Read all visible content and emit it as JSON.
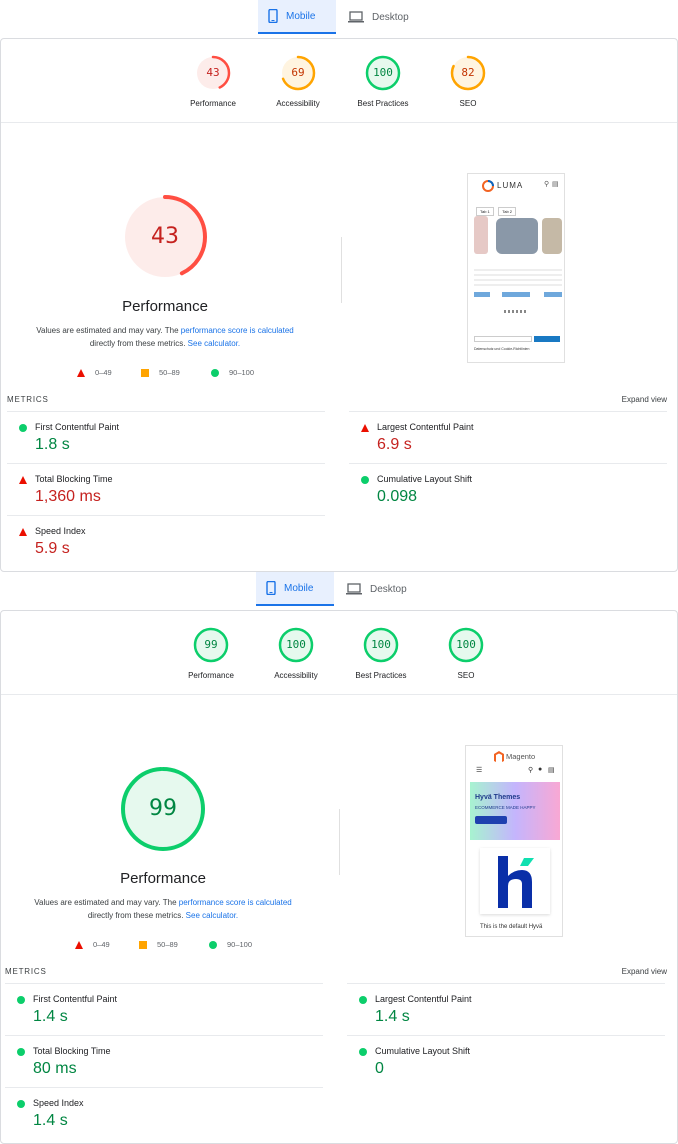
{
  "report1": {
    "tabs": {
      "mobile": "Mobile",
      "desktop": "Desktop"
    },
    "categories": [
      {
        "label": "Performance",
        "score": "43",
        "status": "fail",
        "fraction": 0.43
      },
      {
        "label": "Accessibility",
        "score": "69",
        "status": "average",
        "fraction": 0.69
      },
      {
        "label": "Best Practices",
        "score": "100",
        "status": "pass",
        "fraction": 1.0
      },
      {
        "label": "SEO",
        "score": "82",
        "status": "average",
        "fraction": 0.82
      }
    ],
    "main": {
      "score": "43",
      "title": "Performance",
      "note_prefix": "Values are estimated and may vary. The",
      "note_link1": "performance score is calculated",
      "note_mid": "directly from these metrics.",
      "note_link2": "See calculator."
    },
    "legend": [
      {
        "label": "0–49"
      },
      {
        "label": "50–89"
      },
      {
        "label": "90–100"
      }
    ],
    "screenshot": {
      "brand": "LUMA",
      "tabs": [
        "Tab 1",
        "Tab 2"
      ],
      "consent": "Datenschutz und Cookie-Richtlinien"
    },
    "metrics_heading": "METRICS",
    "expand_label": "Expand view",
    "metrics": [
      {
        "name": "First Contentful Paint",
        "value": "1.8 s",
        "status": "pass"
      },
      {
        "name": "Largest Contentful Paint",
        "value": "6.9 s",
        "status": "fail"
      },
      {
        "name": "Total Blocking Time",
        "value": "1,360 ms",
        "status": "fail"
      },
      {
        "name": "Cumulative Layout Shift",
        "value": "0.098",
        "status": "pass"
      },
      {
        "name": "Speed Index",
        "value": "5.9 s",
        "status": "fail"
      }
    ]
  },
  "report2": {
    "tabs": {
      "mobile": "Mobile",
      "desktop": "Desktop"
    },
    "categories": [
      {
        "label": "Performance",
        "score": "99",
        "status": "pass",
        "fraction": 0.99
      },
      {
        "label": "Accessibility",
        "score": "100",
        "status": "pass",
        "fraction": 1.0
      },
      {
        "label": "Best Practices",
        "score": "100",
        "status": "pass",
        "fraction": 1.0
      },
      {
        "label": "SEO",
        "score": "100",
        "status": "pass",
        "fraction": 1.0
      }
    ],
    "main": {
      "score": "99",
      "title": "Performance",
      "note_prefix": "Values are estimated and may vary. The",
      "note_link1": "performance score is calculated",
      "note_mid": "directly from these metrics.",
      "note_link2": "See calculator."
    },
    "legend": [
      {
        "label": "0–49"
      },
      {
        "label": "50–89"
      },
      {
        "label": "90–100"
      }
    ],
    "screenshot": {
      "brand": "Magento",
      "hero_title": "Hyvä Themes",
      "hero_sub": "ECOMMERCE MADE HAPPY",
      "caption": "This is the default Hyvä"
    },
    "metrics_heading": "METRICS",
    "expand_label": "Expand view",
    "metrics": [
      {
        "name": "First Contentful Paint",
        "value": "1.4 s",
        "status": "pass"
      },
      {
        "name": "Largest Contentful Paint",
        "value": "1.4 s",
        "status": "pass"
      },
      {
        "name": "Total Blocking Time",
        "value": "80 ms",
        "status": "pass"
      },
      {
        "name": "Cumulative Layout Shift",
        "value": "0",
        "status": "pass"
      },
      {
        "name": "Speed Index",
        "value": "1.4 s",
        "status": "pass"
      }
    ]
  },
  "colors": {
    "pass": "#0cce6b",
    "pass_text": "#018642",
    "pass_bg": "#e6f9ee",
    "average": "#ffa400",
    "average_text": "#c33300",
    "average_bg": "#fff4e0",
    "fail": "#ff4e42",
    "fail_text": "#c5221f",
    "fail_bg": "#fdecea",
    "link": "#1a73e8"
  }
}
